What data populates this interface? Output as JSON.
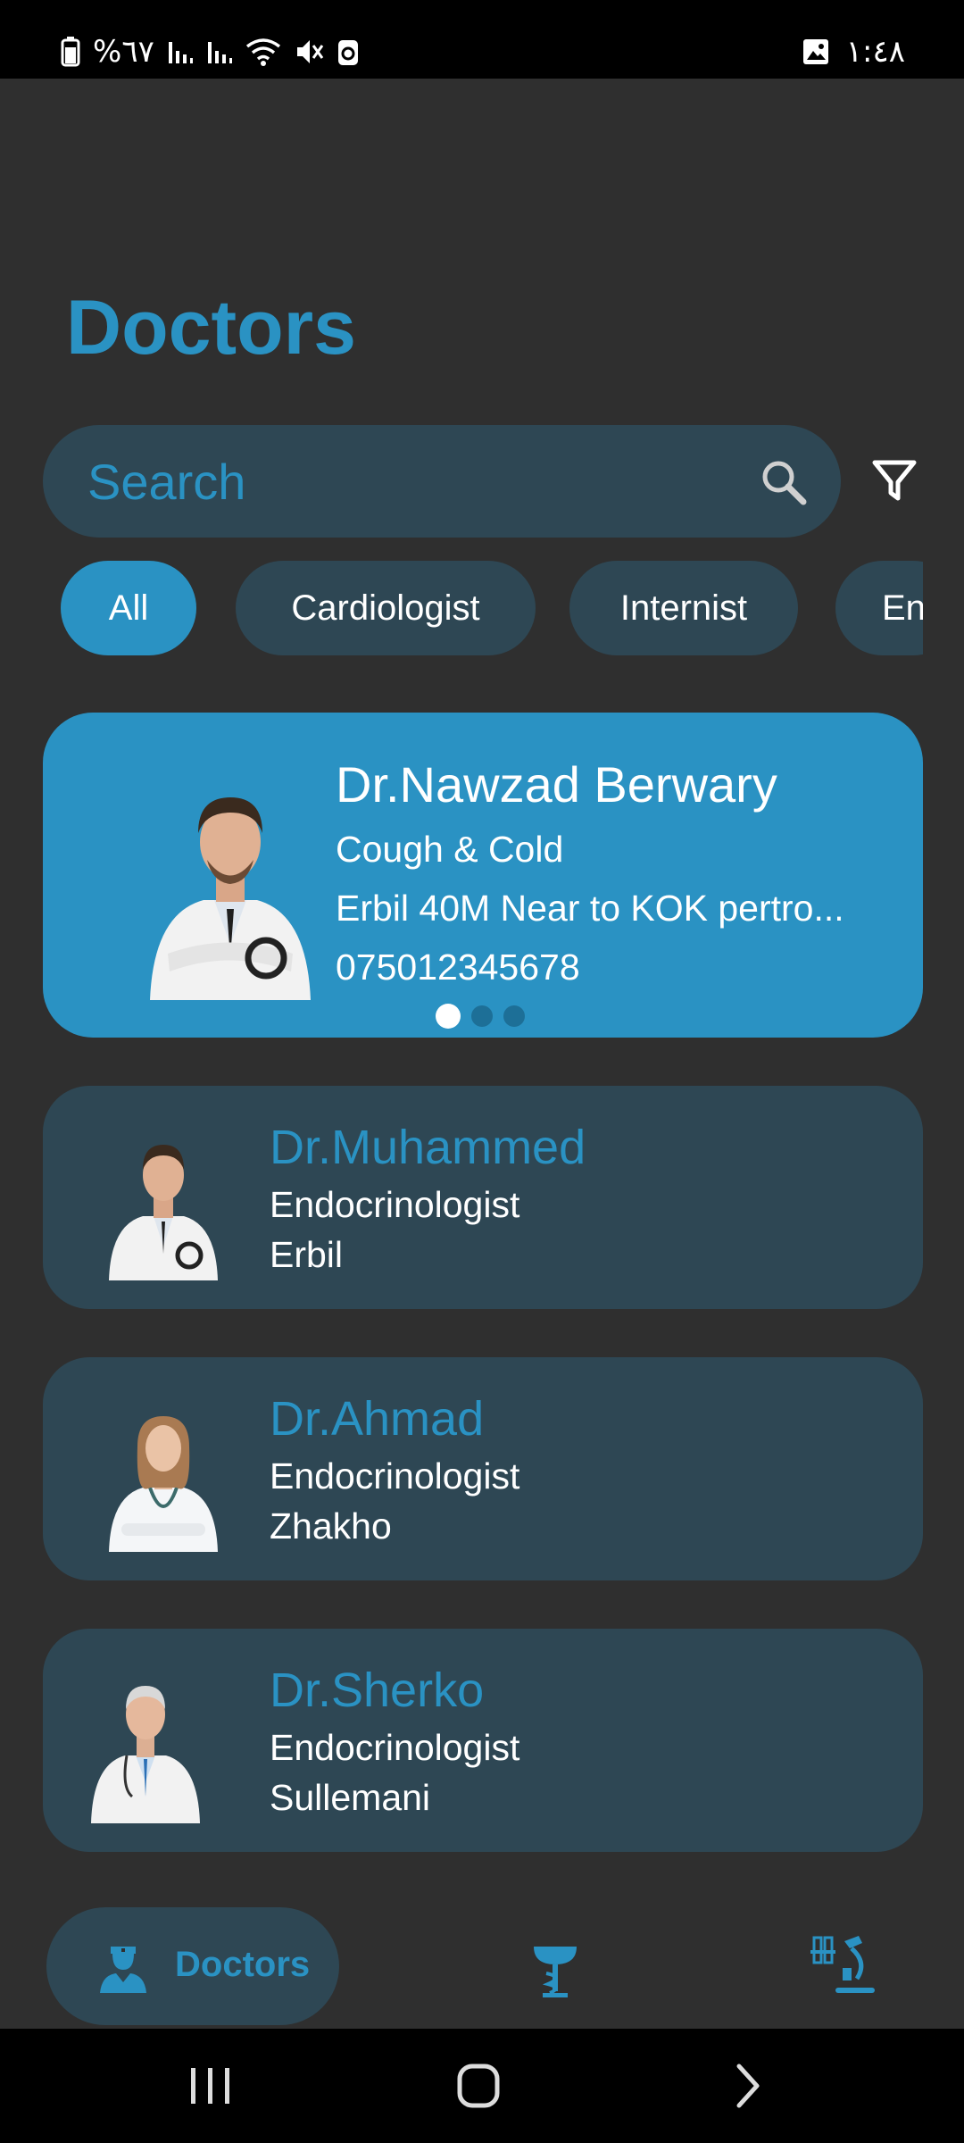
{
  "status_bar": {
    "battery_text": "%٦٧",
    "time": "١:٤٨"
  },
  "page": {
    "title": "Doctors"
  },
  "search": {
    "placeholder": "Search"
  },
  "chips": [
    {
      "label": "All",
      "active": true
    },
    {
      "label": "Cardiologist",
      "active": false
    },
    {
      "label": "Internist",
      "active": false
    },
    {
      "label": "En",
      "active": false
    }
  ],
  "featured": {
    "name": "Dr.Nawzad Berwary",
    "specialty": "Cough & Cold",
    "address": "Erbil 40M Near to KOK pertro...",
    "phone": "075012345678",
    "page_count": 3,
    "current_page": 1
  },
  "doctors": [
    {
      "name": "Dr.Muhammed",
      "specialty": "Endocrinologist",
      "city": "Erbil"
    },
    {
      "name": "Dr.Ahmad",
      "specialty": "Endocrinologist",
      "city": "Zhakho"
    },
    {
      "name": "Dr.Sherko",
      "specialty": "Endocrinologist",
      "city": "Sullemani"
    }
  ],
  "bottom_nav": {
    "doctors_label": "Doctors",
    "items": [
      "doctor-icon",
      "pharmacy-icon",
      "lab-icon"
    ]
  },
  "colors": {
    "accent": "#2a92c3",
    "background": "#2f2f2f",
    "card": "#2e4754"
  }
}
